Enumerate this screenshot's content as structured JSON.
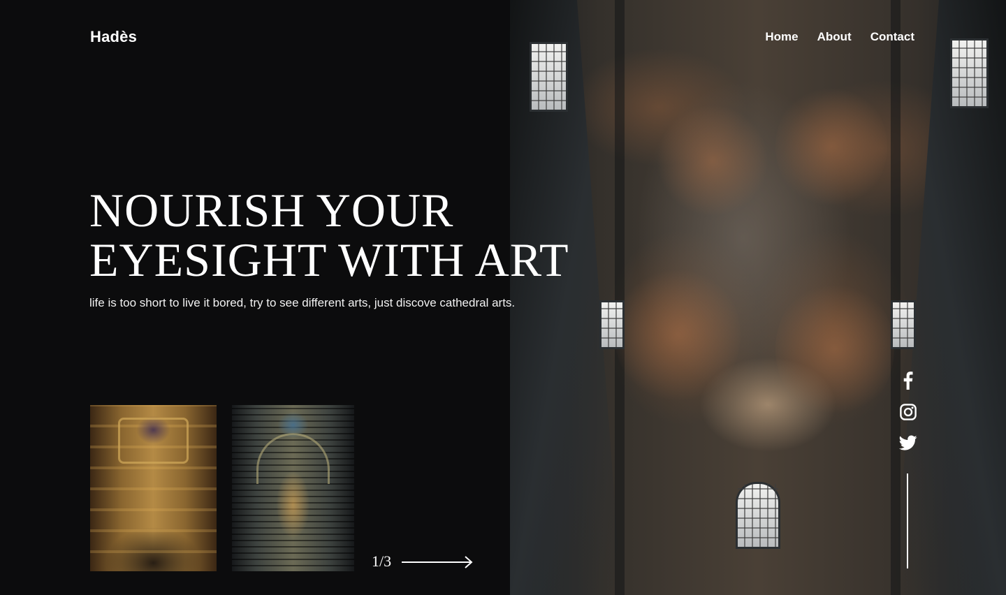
{
  "header": {
    "logo": "Hadès",
    "nav": [
      {
        "label": "Home"
      },
      {
        "label": "About"
      },
      {
        "label": "Contact"
      }
    ]
  },
  "hero": {
    "title_line1": "NOURISH YOUR",
    "title_line2": "EYESIGHT WITH ART",
    "subtitle": "life is too short to live it bored, try to see different arts, just discove cathedral arts.",
    "image_alt": "baroque cathedral ceiling fresco"
  },
  "gallery": {
    "thumbnails": [
      {
        "alt": "gilded palace gallery hall"
      },
      {
        "alt": "cathedral nave with pews"
      }
    ],
    "pager": "1/3",
    "next_icon": "arrow-right-icon"
  },
  "social": {
    "icons": [
      "facebook-icon",
      "instagram-icon",
      "twitter-icon"
    ]
  },
  "colors": {
    "background": "#0c0c0d",
    "text": "#ffffff"
  }
}
